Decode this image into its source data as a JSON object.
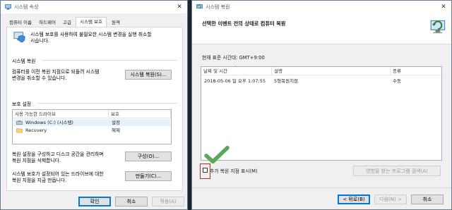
{
  "left_window": {
    "title": "시스템 속성",
    "tabs": [
      "컴퓨터 이름",
      "하드웨어",
      "고급",
      "시스템 보호",
      "원격"
    ],
    "active_tab": "시스템 보호",
    "intro_text_line1": "시스템 보호를 사용하여 불필요한 시스템 변경을 실행 취소할",
    "intro_text_line2": "시습니다.",
    "restore_section_title": "시스템 복원",
    "restore_desc_line1": "컴퓨터를 이전 복원 지점으로 되돌려 시스템",
    "restore_desc_line2": "변경을 취소할 수 있습니다.",
    "restore_button": "시스템 복원(S)...",
    "protection_section_title": "보호 설정",
    "drive_col_header": "사용 가능한 드라이브",
    "protect_col_header": "보호",
    "drives": [
      {
        "name": "Windows (C:) (시스템)",
        "status": "설정"
      },
      {
        "name": "Recovery",
        "status": "해제"
      }
    ],
    "configure_desc_line1": "복원 설정을 구성하고 디스크 공간을 관리하며",
    "configure_desc_line2": "복원 지점을 삭제합니다.",
    "configure_button": "구성(O)...",
    "create_desc_line1": "시스템 보호가 설정되어 있는 드라이브에 대한",
    "create_desc_line2": "복원 지점을 지금 만듭니다.",
    "create_button": "만들기(C)...",
    "ok_button": "확인",
    "cancel_button": "취소",
    "apply_button": "적용(A)"
  },
  "right_window": {
    "title": "시스템 복원",
    "heading": "선택한 이벤트 전의 상태로 컴퓨터 복원",
    "timezone_label": "현재 표준 시간대: GMT+9:00",
    "columns": [
      "날짜 및 시간",
      "설명",
      "종류"
    ],
    "rows": [
      {
        "datetime": "2018-05-06 일 오후 1:07:55",
        "description": "5형복원지점",
        "type": "수동"
      }
    ],
    "show_more_checkbox": "추가 복원 지점 표시(M)",
    "show_more_checked": false,
    "scan_button": "영향을 받는 프로그램 검색(A)",
    "back_button": "< 뒤로(B)",
    "next_button": "다음(N) >",
    "cancel_button": "취소"
  },
  "colors": {
    "checkmark": "#5aa85a",
    "highlight_box": "#e02020",
    "selected_drive_bg": "#e5f1fb"
  }
}
